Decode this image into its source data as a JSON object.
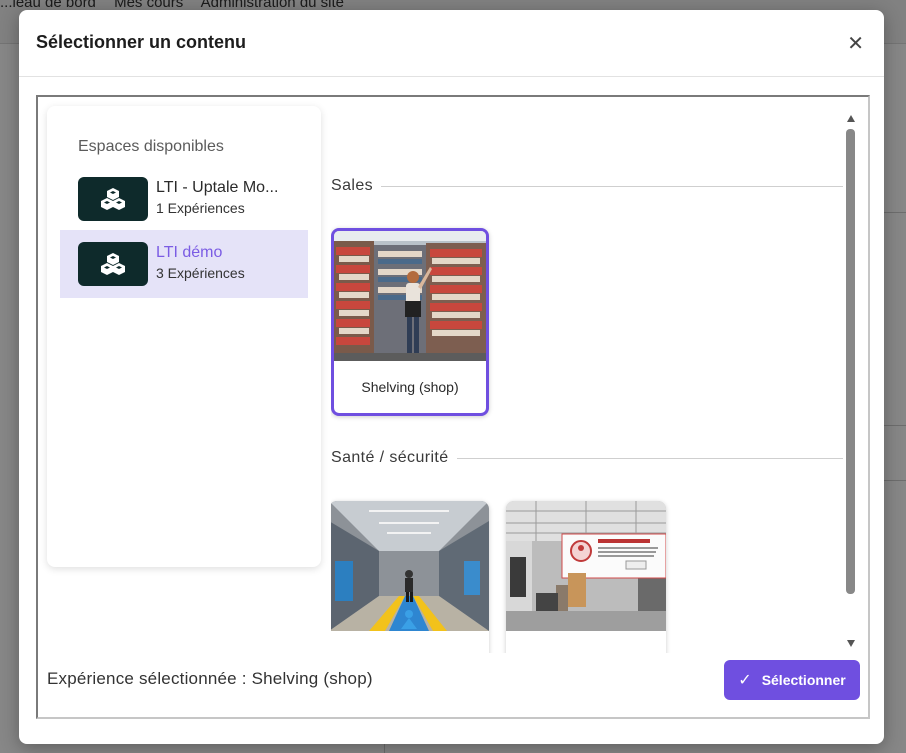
{
  "background": {
    "nav": [
      "...leau de bord",
      "Mes cours",
      "Administration du site"
    ]
  },
  "modal": {
    "title": "Sélectionner un contenu",
    "close_icon": "close-icon"
  },
  "spaces": {
    "title": "Espaces disponibles",
    "items": [
      {
        "name": "LTI - Uptale Mo...",
        "count": "1 Expériences",
        "icon": "cubes-icon",
        "active": false
      },
      {
        "name": "LTI démo",
        "count": "3 Expériences",
        "icon": "cubes-icon",
        "active": true
      }
    ]
  },
  "sections": [
    {
      "title": "Sales",
      "cards": [
        {
          "label": "Shelving (shop)",
          "selected": true
        }
      ]
    },
    {
      "title": "Santé / sécurité",
      "cards": [
        {
          "label": "",
          "selected": false
        },
        {
          "label": "",
          "selected": false
        }
      ]
    }
  ],
  "footer": {
    "selected_text": "Expérience sélectionnée : Shelving (shop)",
    "select_button": "Sélectionner"
  },
  "colors": {
    "accent": "#6f4fe0",
    "active_bg": "#e5e3f8",
    "icon_bg": "#0e2a2b"
  }
}
